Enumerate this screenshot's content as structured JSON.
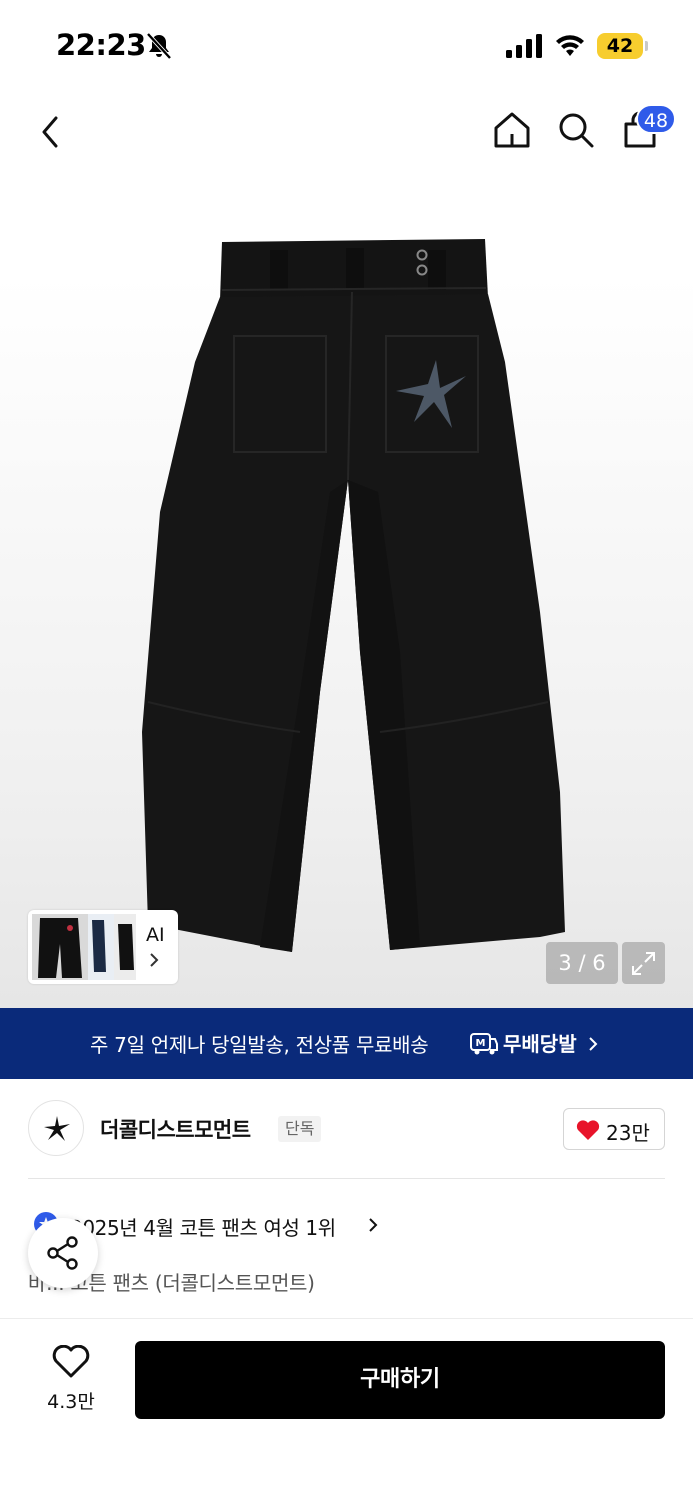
{
  "status_bar": {
    "time": "22:23",
    "battery": "42"
  },
  "header": {
    "cart_count": "48"
  },
  "gallery": {
    "thumb_label": "AI",
    "page_counter": "3 / 6"
  },
  "promo": {
    "text": "주 7일 언제나 당일발송, 전상품 무료배송",
    "badge_label": "무배당발",
    "badge_letter": "M"
  },
  "brand": {
    "name": "더콜디스트모먼트",
    "tag": "단독",
    "like_count": "23만"
  },
  "ranking": {
    "text": "2025년 4월 코튼 팬츠 여성 1위"
  },
  "product": {
    "name": "바... 코튼 팬츠 (더콜디스트모먼트)"
  },
  "bottom_bar": {
    "wish_count": "4.3만",
    "buy_label": "구매하기"
  },
  "colors": {
    "promo_bg": "#0a2a7a",
    "badge_blue": "#2f5be9",
    "heart_red": "#e8142a",
    "battery_yellow": "#f7cd2e"
  }
}
